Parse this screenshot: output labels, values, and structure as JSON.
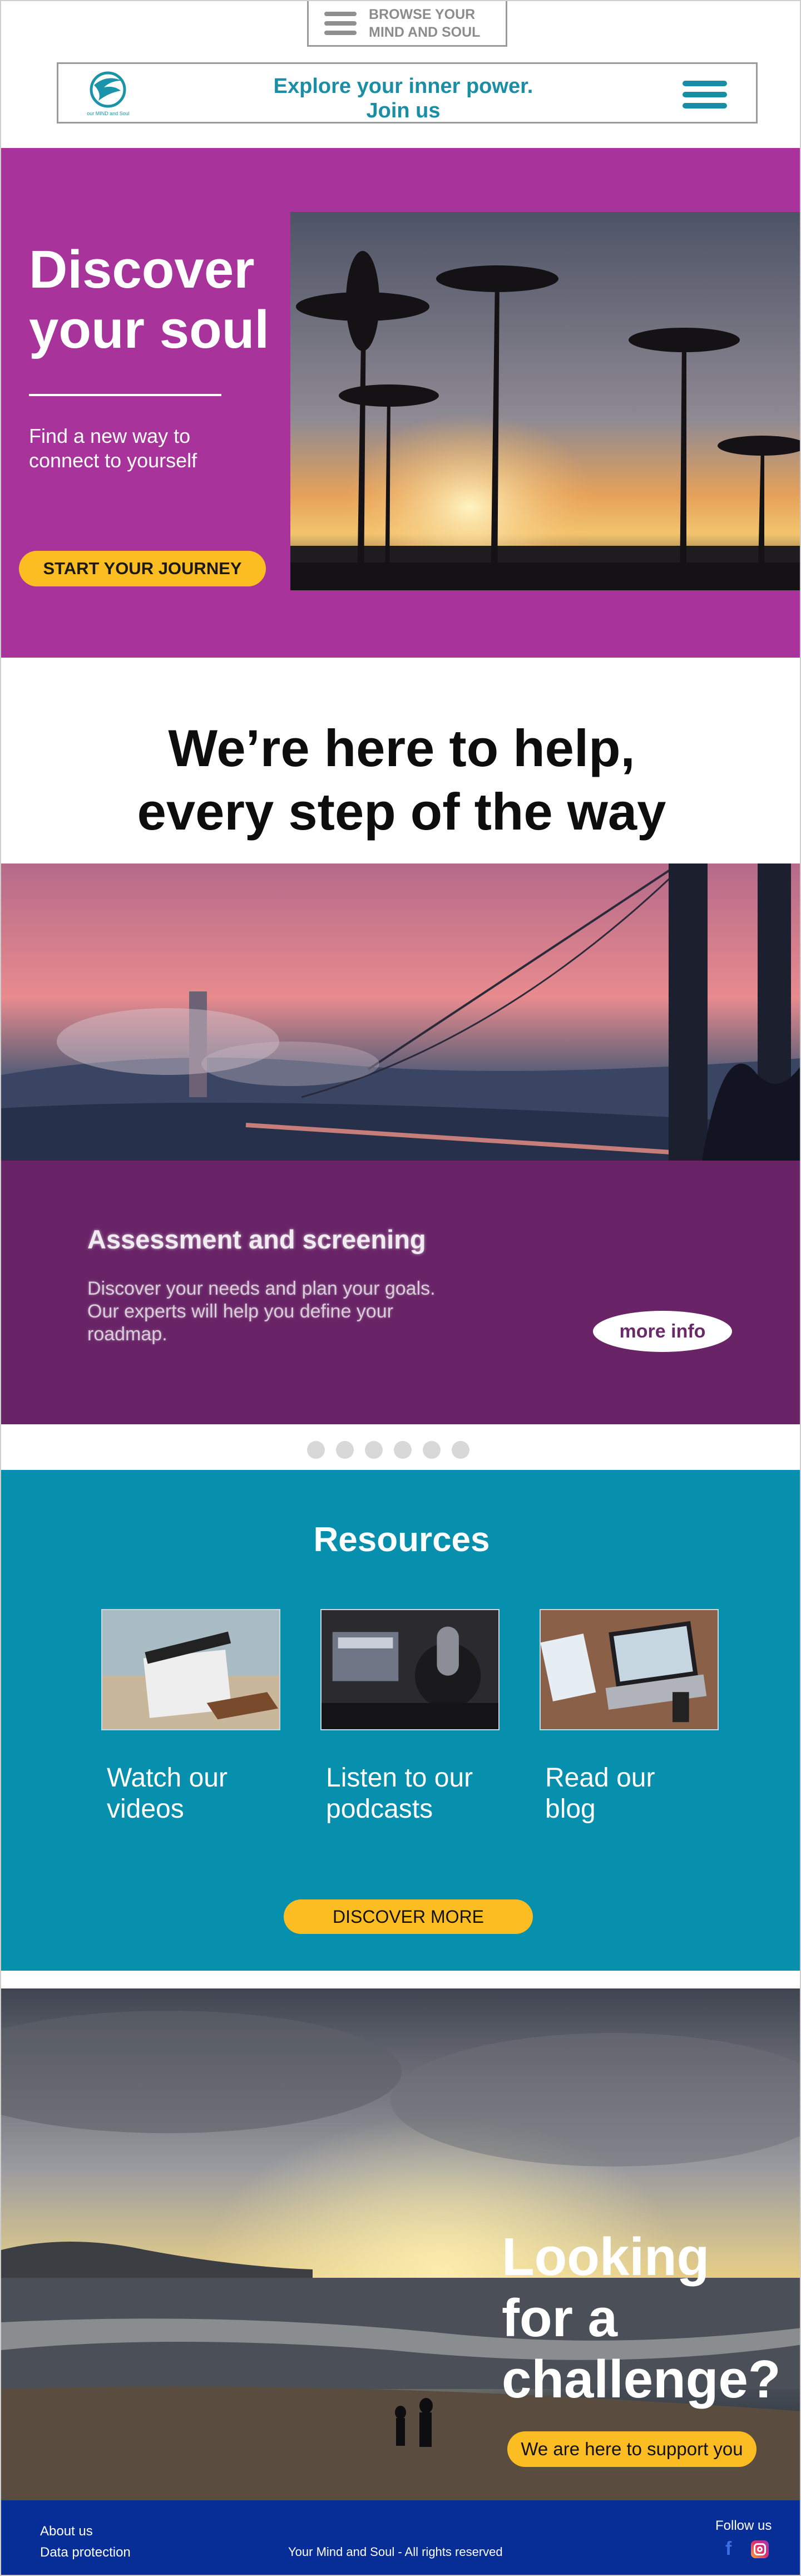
{
  "browse": {
    "label_line1": "BROWSE YOUR",
    "label_line2": "MIND AND SOUL"
  },
  "header": {
    "logo_caption": "our MIND and Soul",
    "tagline_line1": "Explore your inner power.",
    "tagline_line2": "Join us"
  },
  "hero": {
    "title_line1": "Discover",
    "title_line2": "your soul",
    "subtitle_line1": "Find a new way to",
    "subtitle_line2": "connect to yourself",
    "cta_label": "START YOUR JOURNEY"
  },
  "help": {
    "title_line1": "We’re here to help,",
    "title_line2": "every step of the way"
  },
  "carousel": {
    "slide_title": "Assessment and screening",
    "slide_text_line1": "Discover your needs and plan your goals.",
    "slide_text_line2": "Our experts will help you define your",
    "slide_text_line3": "roadmap.",
    "more_label": "more info",
    "dot_count": 6
  },
  "resources": {
    "title": "Resources",
    "cards": [
      {
        "label_line1": "Watch our",
        "label_line2": "videos",
        "icon": "clapperboard-photo"
      },
      {
        "label_line1": "Listen to our",
        "label_line2": "podcasts",
        "icon": "studio-microphone-photo"
      },
      {
        "label_line1": "Read our",
        "label_line2": "blog",
        "icon": "laptop-desk-photo"
      }
    ],
    "cta_label": "DISCOVER MORE"
  },
  "challenge": {
    "title_line1": "Looking",
    "title_line2": "for a",
    "title_line3": "challenge?",
    "cta_label": "We are here to support you"
  },
  "footer": {
    "about": "About us",
    "privacy": "Data protection",
    "rights": "Your Mind and Soul - All rights reserved",
    "follow": "Follow us",
    "facebook_glyph": "f",
    "icons": [
      "facebook-icon",
      "instagram-icon"
    ]
  },
  "colors": {
    "hero_bg": "#a7339b",
    "accent_yellow": "#fcbd23",
    "teal": "#078fae",
    "carousel_panel": "#682466",
    "footer_bg": "#072d96"
  }
}
